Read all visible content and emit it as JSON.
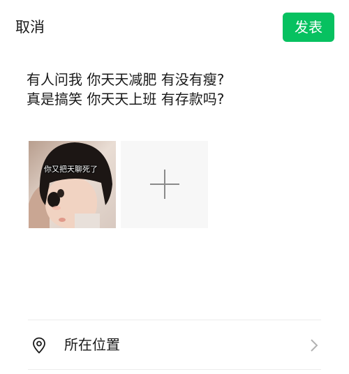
{
  "header": {
    "cancel_label": "取消",
    "publish_label": "发表"
  },
  "post": {
    "lines": [
      "有人问我 你天天减肥 有没有瘦?",
      "真是搞笑 你天天上班 有存款吗?"
    ]
  },
  "media": {
    "photo_caption": "你又把天聊死了"
  },
  "location": {
    "label": "所在位置"
  },
  "colors": {
    "accent": "#07c160"
  },
  "icons": {
    "add": "plus-icon",
    "location": "location-pin-icon",
    "chevron": "chevron-right-icon"
  }
}
